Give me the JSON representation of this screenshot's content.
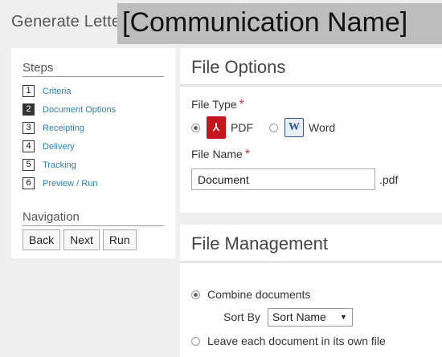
{
  "header": {
    "title": "Generate Letters",
    "communication_name": "[Communication Name]"
  },
  "sidebar": {
    "steps_heading": "Steps",
    "steps": [
      {
        "num": "1",
        "label": "Criteria"
      },
      {
        "num": "2",
        "label": "Document Options"
      },
      {
        "num": "3",
        "label": "Receipting"
      },
      {
        "num": "4",
        "label": "Delivery"
      },
      {
        "num": "5",
        "label": "Tracking"
      },
      {
        "num": "6",
        "label": "Preview / Run"
      }
    ],
    "active_step": "2",
    "navigation_heading": "Navigation",
    "buttons": {
      "back": "Back",
      "next": "Next",
      "run": "Run"
    }
  },
  "file_options": {
    "title": "File Options",
    "file_type_label": "File Type",
    "required_marker": "*",
    "options": {
      "pdf": "PDF",
      "word": "Word"
    },
    "selected_type": "PDF",
    "file_name_label": "File Name",
    "file_name_value": "Document",
    "extension": ".pdf",
    "icons": {
      "pdf": "pdf-file-icon",
      "word": "word-file-icon"
    }
  },
  "file_management": {
    "title": "File Management",
    "combine_label": "Combine documents",
    "sort_by_label": "Sort By",
    "sort_by_value": "Sort Name",
    "separate_label": "Leave each document in its own file",
    "selected": "Combine documents"
  },
  "colors": {
    "link": "#2a7fb8",
    "required": "#d33",
    "pdf": "#c4161c",
    "word": "#2b579a",
    "name_banner": "#bdbdbd"
  }
}
